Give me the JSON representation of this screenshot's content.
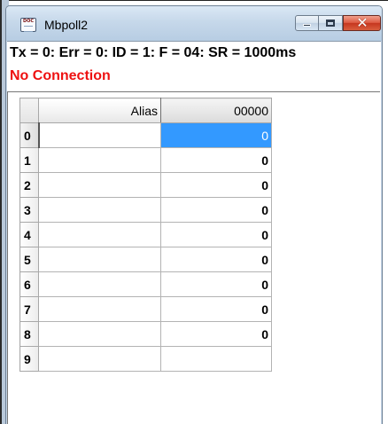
{
  "window": {
    "title": "Mbpoll2",
    "icon": "mbpoll-document-icon",
    "icon_text": "DOC",
    "controls": [
      "minimize-icon",
      "maximize-icon",
      "close-icon"
    ],
    "close_glyph": "✕"
  },
  "status": {
    "line": "Tx = 0: Err = 0: ID = 1: F = 04: SR = 1000ms",
    "connection": "No Connection",
    "connection_color": "#ee1111"
  },
  "grid": {
    "headers": {
      "alias": "Alias",
      "register": "00000"
    },
    "rows": [
      {
        "index": "0",
        "alias": "",
        "value": "0"
      },
      {
        "index": "1",
        "alias": "",
        "value": "0"
      },
      {
        "index": "2",
        "alias": "",
        "value": "0"
      },
      {
        "index": "3",
        "alias": "",
        "value": "0"
      },
      {
        "index": "4",
        "alias": "",
        "value": "0"
      },
      {
        "index": "5",
        "alias": "",
        "value": "0"
      },
      {
        "index": "6",
        "alias": "",
        "value": "0"
      },
      {
        "index": "7",
        "alias": "",
        "value": "0"
      },
      {
        "index": "8",
        "alias": "",
        "value": "0"
      },
      {
        "index": "9",
        "alias": "",
        "value": ""
      }
    ],
    "selected_row": "0",
    "selection_color": "#3399ff"
  }
}
